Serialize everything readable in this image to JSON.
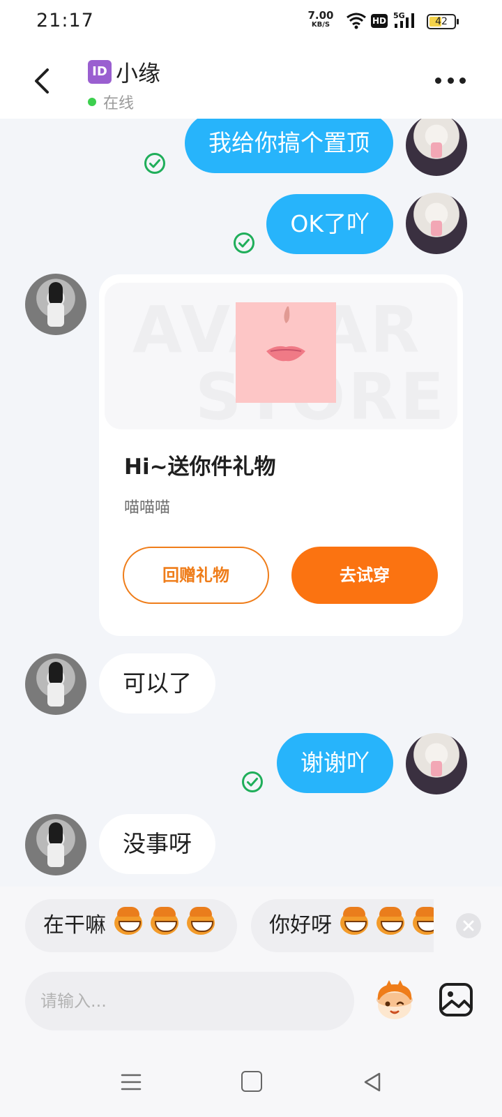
{
  "status_bar": {
    "time": "21:17",
    "net_speed_value": "7.00",
    "net_speed_unit": "KB/S",
    "hd_label": "HD",
    "network_label": "5G",
    "battery": "42"
  },
  "header": {
    "id_badge": "ID",
    "name": "小缘",
    "status": "在线"
  },
  "messages": [
    {
      "text": "我给你搞个置顶",
      "from": "me"
    },
    {
      "text": "OK了吖",
      "from": "me"
    },
    {
      "text": "可以了",
      "from": "her"
    },
    {
      "text": "谢谢吖",
      "from": "me"
    },
    {
      "text": "没事呀",
      "from": "her"
    }
  ],
  "gift_card": {
    "title": "Hi~送你件礼物",
    "subtitle": "喵喵喵",
    "return_button": "回赠礼物",
    "try_button": "去试穿",
    "watermark_line1": "AVATAR",
    "watermark_line2": "STORE"
  },
  "quick_replies": [
    {
      "text": "在干嘛"
    },
    {
      "text": "你好呀"
    }
  ],
  "input": {
    "placeholder": "请输入..."
  },
  "colors": {
    "outgoing_bubble": "#27b4fb",
    "accent_orange": "#fb7311",
    "online_green": "#3ccf4e",
    "read_check_green": "#1fae5a"
  }
}
